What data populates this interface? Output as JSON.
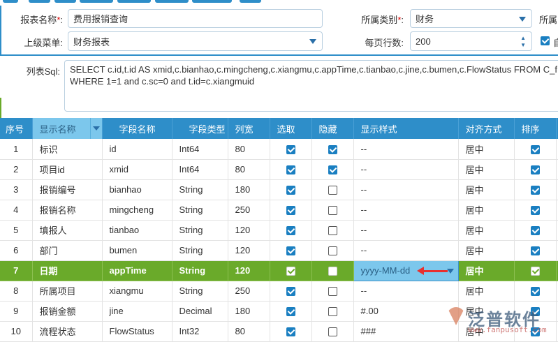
{
  "form": {
    "report_name_label": "报表名称",
    "report_name": "费用报销查询",
    "category_label": "所属类别",
    "category": "财务",
    "belong_label_partial": "所属",
    "parent_menu_label": "上级菜单",
    "parent_menu": "财务报表",
    "rows_per_page_label": "每页行数",
    "rows_per_page": "200",
    "auto_label_partial": "自",
    "required_mark": "*",
    "colon": ":",
    "sql_label": "列表Sql:",
    "sql": "SELECT c.id,t.id AS xmid,c.bianhao,c.mingcheng,c.xiangmu,c.appTime,c.tianbao,c.jine,c.bumen,c.FlowStatus FROM C_f\nWHERE 1=1 and c.sc=0 and t.id=c.xiangmuid"
  },
  "table": {
    "headers": [
      "序号",
      "显示名称",
      "字段名称",
      "字段类型",
      "列宽",
      "选取",
      "隐藏",
      "显示样式",
      "对齐方式",
      "排序"
    ],
    "rows": [
      {
        "no": "1",
        "display": "标识",
        "field": "id",
        "type": "Int64",
        "width": "80",
        "select": true,
        "hide": true,
        "format": "--",
        "align": "居中",
        "sort": true
      },
      {
        "no": "2",
        "display": "项目id",
        "field": "xmid",
        "type": "Int64",
        "width": "80",
        "select": true,
        "hide": true,
        "format": "--",
        "align": "居中",
        "sort": true
      },
      {
        "no": "3",
        "display": "报销编号",
        "field": "bianhao",
        "type": "String",
        "width": "180",
        "select": true,
        "hide": false,
        "format": "--",
        "align": "居中",
        "sort": true
      },
      {
        "no": "4",
        "display": "报销名称",
        "field": "mingcheng",
        "type": "String",
        "width": "250",
        "select": true,
        "hide": false,
        "format": "--",
        "align": "居中",
        "sort": true
      },
      {
        "no": "5",
        "display": "填报人",
        "field": "tianbao",
        "type": "String",
        "width": "120",
        "select": true,
        "hide": false,
        "format": "--",
        "align": "居中",
        "sort": true
      },
      {
        "no": "6",
        "display": "部门",
        "field": "bumen",
        "type": "String",
        "width": "120",
        "select": true,
        "hide": false,
        "format": "--",
        "align": "居中",
        "sort": true
      },
      {
        "no": "7",
        "display": "日期",
        "field": "appTime",
        "type": "String",
        "width": "120",
        "select": true,
        "hide": false,
        "format": "yyyy-MM-dd",
        "align": "居中",
        "sort": true,
        "selected": true
      },
      {
        "no": "8",
        "display": "所属项目",
        "field": "xiangmu",
        "type": "String",
        "width": "250",
        "select": true,
        "hide": false,
        "format": "--",
        "align": "居中",
        "sort": true
      },
      {
        "no": "9",
        "display": "报销金额",
        "field": "jine",
        "type": "Decimal",
        "width": "180",
        "select": true,
        "hide": false,
        "format": "#.00",
        "align": "居中",
        "sort": true
      },
      {
        "no": "10",
        "display": "流程状态",
        "field": "FlowStatus",
        "type": "Int32",
        "width": "80",
        "select": true,
        "hide": false,
        "format": "###",
        "align": "居中",
        "sort": true
      }
    ]
  },
  "watermark": {
    "name": "泛普软件",
    "url": "www.fanpusoft.com"
  },
  "colors": {
    "header": "#2e8ec9",
    "selected_row": "#6aaa2a",
    "edit_cell": "#7cc7ec"
  }
}
